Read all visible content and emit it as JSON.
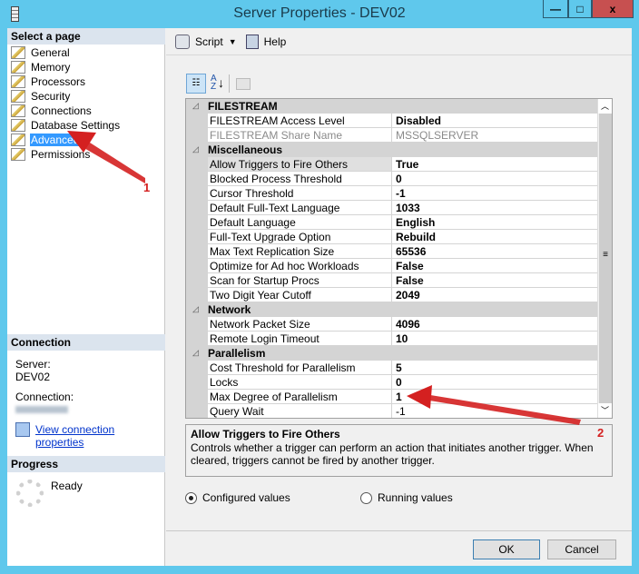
{
  "window": {
    "title": "Server Properties - DEV02",
    "minimize": "—",
    "maximize": "□",
    "close": "x"
  },
  "sidebar": {
    "header": "Select a page",
    "items": [
      {
        "label": "General"
      },
      {
        "label": "Memory"
      },
      {
        "label": "Processors"
      },
      {
        "label": "Security"
      },
      {
        "label": "Connections"
      },
      {
        "label": "Database Settings"
      },
      {
        "label": "Advanced",
        "selected": true
      },
      {
        "label": "Permissions"
      }
    ]
  },
  "connection": {
    "header": "Connection",
    "server_label": "Server:",
    "server_value": "DEV02",
    "connection_label": "Connection:",
    "link": "View connection properties"
  },
  "progress": {
    "header": "Progress",
    "status": "Ready"
  },
  "toolbar": {
    "script": "Script",
    "help": "Help"
  },
  "grid": {
    "rows": [
      {
        "type": "cat",
        "name": "FILESTREAM"
      },
      {
        "name": "FILESTREAM Access Level",
        "value": "Disabled"
      },
      {
        "name": "FILESTREAM Share Name",
        "value": "MSSQLSERVER",
        "disabled": true
      },
      {
        "type": "cat",
        "name": "Miscellaneous"
      },
      {
        "name": "Allow Triggers to Fire Others",
        "value": "True",
        "selected": true
      },
      {
        "name": "Blocked Process Threshold",
        "value": "0"
      },
      {
        "name": "Cursor Threshold",
        "value": "-1"
      },
      {
        "name": "Default Full-Text Language",
        "value": "1033"
      },
      {
        "name": "Default Language",
        "value": "English"
      },
      {
        "name": "Full-Text Upgrade Option",
        "value": "Rebuild"
      },
      {
        "name": "Max Text Replication Size",
        "value": "65536"
      },
      {
        "name": "Optimize for Ad hoc Workloads",
        "value": "False"
      },
      {
        "name": "Scan for Startup Procs",
        "value": "False"
      },
      {
        "name": "Two Digit Year Cutoff",
        "value": "2049"
      },
      {
        "type": "cat",
        "name": "Network"
      },
      {
        "name": "Network Packet Size",
        "value": "4096"
      },
      {
        "name": "Remote Login Timeout",
        "value": "10"
      },
      {
        "type": "cat",
        "name": "Parallelism"
      },
      {
        "name": "Cost Threshold for Parallelism",
        "value": "5"
      },
      {
        "name": "Locks",
        "value": "0"
      },
      {
        "name": "Max Degree of Parallelism",
        "value": "1"
      },
      {
        "name": "Query Wait",
        "value": "-1",
        "plain": true
      }
    ]
  },
  "description": {
    "title": "Allow Triggers to Fire Others",
    "text": "Controls whether a trigger can perform an action that initiates another trigger. When cleared, triggers cannot be fired by another trigger."
  },
  "options": {
    "configured": "Configured values",
    "running": "Running values",
    "selected": "configured"
  },
  "buttons": {
    "ok": "OK",
    "cancel": "Cancel"
  },
  "annotations": {
    "one": "1",
    "two": "2",
    "color": "#d42020"
  }
}
